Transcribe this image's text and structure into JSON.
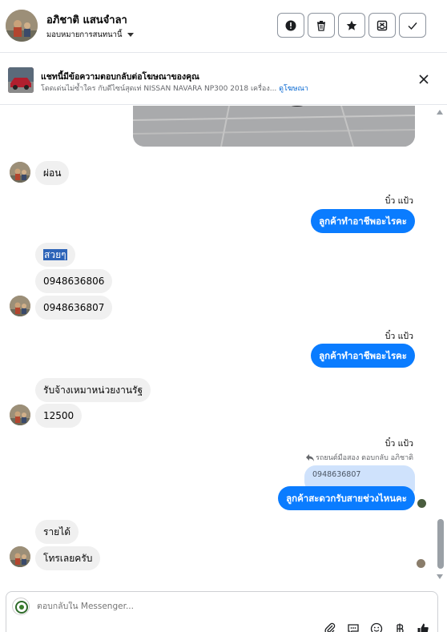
{
  "header": {
    "contact_name": "อภิชาติ แสนจำลา",
    "assign_label": "มอบหมายการสนทนานี้",
    "buttons": [
      "report-icon",
      "trash-icon",
      "star-icon",
      "archive-icon",
      "check-icon"
    ]
  },
  "ad_banner": {
    "title": "แชทนี้มีข้อความตอบกลับต่อโฆษณาของคุณ",
    "subtitle": "โดดเด่นไม่ซ้ำใคร กับดีไซน์สุดเท่ NISSAN NAVARA NP300 2018 เครื่อง... ",
    "link": "ดูโฆษณา"
  },
  "messages": {
    "in_1": "ผ่อน",
    "out_sender_1": "บิ๋ว แป้ว",
    "out_1": "ลูกค้าทำอาชีพอะไรคะ",
    "in_2": "สวยๆ",
    "in_3": "0948636806",
    "in_4": "0948636807",
    "out_sender_2": "บิ๋ว แป้ว",
    "out_2": "ลูกค้าทำอาชีพอะไรคะ",
    "in_5": "รับจ้างเหมาหน่วยงานรัฐ",
    "in_6": "12500",
    "out_sender_3": "บิ๋ว แป้ว",
    "reply_meta": "รถยนต์มือสอง ตอบกลับ อภิชาติ",
    "quoted": "0948636807",
    "out_3": "ลูกค้าสะดวกรับสายช่วงไหนคะ",
    "in_7": "รายได้",
    "in_8": "โทรเลยครับ"
  },
  "composer": {
    "placeholder": "ตอบกลับใน Messenger..."
  },
  "colors": {
    "outgoing": "#0a7cff",
    "incoming": "#f0f0f0",
    "link": "#0064d1",
    "quoted": "#cfe2fc"
  }
}
